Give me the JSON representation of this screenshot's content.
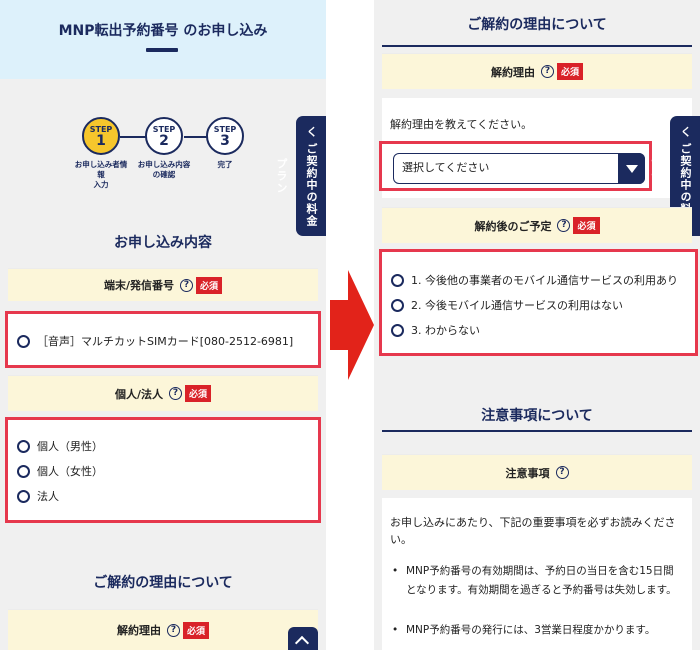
{
  "left": {
    "header_title": "MNP転出予約番号 のお申し込み",
    "steps": [
      {
        "label": "STEP",
        "num": "1",
        "caption": "お申し込み者情\n報\n入力",
        "active": true
      },
      {
        "label": "STEP",
        "num": "2",
        "caption": "お申し込み内容\nの確認",
        "active": false
      },
      {
        "label": "STEP",
        "num": "3",
        "caption": "完了",
        "active": false
      }
    ],
    "side_tab": "く ご契約中の料金プラン",
    "section_title": "お申し込み内容",
    "terminal_label": "端末/発信番号",
    "terminal_option": "［音声］マルチカットSIMカード[080-2512-6981]",
    "entity_label": "個人/法人",
    "entity_options": [
      "個人（男性）",
      "個人（女性）",
      "法人"
    ],
    "reason_section_title": "ご解約の理由について",
    "reason_label": "解約理由"
  },
  "right": {
    "section_title": "ご解約の理由について",
    "reason_label": "解約理由",
    "reason_prompt": "解約理由を教えてください。",
    "reason_select": "選択してください",
    "side_tab": "く ご契約中の料金プラン",
    "plan_label": "解約後のご予定",
    "plan_options": [
      "1. 今後他の事業者のモバイル通信サービスの利用あり",
      "2. 今後モバイル通信サービスの利用はない",
      "3. わからない"
    ],
    "notes_section_title": "注意事項について",
    "notes_label": "注意事項",
    "notes_intro": "お申し込みにあたり、下記の重要事項を必ずお読みください。",
    "notes_items": [
      "MNP予約番号の有効期間は、予約日の当日を含む15日間となります。有効期間を過ぎると予約番号は失効します。",
      "MNP予約番号の発行には、3営業日程度かかります。"
    ]
  },
  "badges": {
    "required": "必須",
    "help": "?"
  },
  "colors": {
    "navy": "#1b2a5e",
    "highlight": "#e6384d",
    "arrow": "#e2231a",
    "required": "#d92228",
    "step_active": "#f6c62c"
  }
}
